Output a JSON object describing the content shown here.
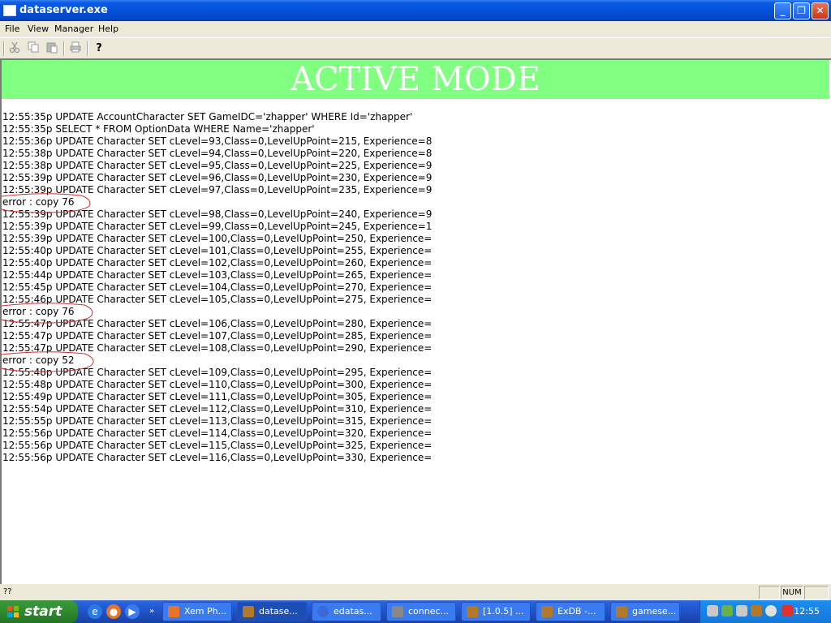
{
  "window": {
    "title": "dataserver.exe",
    "buttons": {
      "minimize": "_",
      "restore": "❐",
      "close": "✕"
    }
  },
  "menu": [
    "File",
    "View",
    "Manager",
    "Help"
  ],
  "toolbar": {
    "icons": [
      "scissors-icon",
      "copy-icon",
      "paste-icon",
      "print-icon",
      "help-icon"
    ],
    "help_glyph": "?"
  },
  "banner": {
    "text": "ACTIVE MODE",
    "color": "#80ff80"
  },
  "log": [
    "12:55:35p UPDATE AccountCharacter SET GameIDC='zhapper' WHERE Id='zhapper'",
    "12:55:35p SELECT * FROM OptionData WHERE Name='zhapper'",
    "12:55:36p UPDATE Character SET cLevel=93,Class=0,LevelUpPoint=215, Experience=8",
    "12:55:38p UPDATE Character SET cLevel=94,Class=0,LevelUpPoint=220, Experience=8",
    "12:55:38p UPDATE Character SET cLevel=95,Class=0,LevelUpPoint=225, Experience=9",
    "12:55:39p UPDATE Character SET cLevel=96,Class=0,LevelUpPoint=230, Experience=9",
    "12:55:39p UPDATE Character SET cLevel=97,Class=0,LevelUpPoint=235, Experience=9",
    "error : copy 76",
    "12:55:39p UPDATE Character SET cLevel=98,Class=0,LevelUpPoint=240, Experience=9",
    "12:55:39p UPDATE Character SET cLevel=99,Class=0,LevelUpPoint=245, Experience=1",
    "12:55:39p UPDATE Character SET cLevel=100,Class=0,LevelUpPoint=250, Experience=",
    "12:55:40p UPDATE Character SET cLevel=101,Class=0,LevelUpPoint=255, Experience=",
    "12:55:40p UPDATE Character SET cLevel=102,Class=0,LevelUpPoint=260, Experience=",
    "12:55:44p UPDATE Character SET cLevel=103,Class=0,LevelUpPoint=265, Experience=",
    "12:55:45p UPDATE Character SET cLevel=104,Class=0,LevelUpPoint=270, Experience=",
    "12:55:46p UPDATE Character SET cLevel=105,Class=0,LevelUpPoint=275, Experience=",
    "error : copy 76",
    "12:55:47p UPDATE Character SET cLevel=106,Class=0,LevelUpPoint=280, Experience=",
    "12:55:47p UPDATE Character SET cLevel=107,Class=0,LevelUpPoint=285, Experience=",
    "12:55:47p UPDATE Character SET cLevel=108,Class=0,LevelUpPoint=290, Experience=",
    "error : copy 52",
    "12:55:48p UPDATE Character SET cLevel=109,Class=0,LevelUpPoint=295, Experience=",
    "12:55:48p UPDATE Character SET cLevel=110,Class=0,LevelUpPoint=300, Experience=",
    "12:55:49p UPDATE Character SET cLevel=111,Class=0,LevelUpPoint=305, Experience=",
    "12:55:54p UPDATE Character SET cLevel=112,Class=0,LevelUpPoint=310, Experience=",
    "12:55:55p UPDATE Character SET cLevel=113,Class=0,LevelUpPoint=315, Experience=",
    "12:55:56p UPDATE Character SET cLevel=114,Class=0,LevelUpPoint=320, Experience=",
    "12:55:56p UPDATE Character SET cLevel=115,Class=0,LevelUpPoint=325, Experience=",
    "12:55:56p UPDATE Character SET cLevel=116,Class=0,LevelUpPoint=330, Experience="
  ],
  "statusbar": {
    "text": "??",
    "panes": [
      "",
      "NUM",
      ""
    ]
  },
  "taskbar": {
    "start_label": "start",
    "overflow_glyph": "»",
    "tasks": [
      {
        "label": "Xem Ph...",
        "active": false,
        "icon_color": "#e8742a"
      },
      {
        "label": "datase...",
        "active": true,
        "icon_color": "#b07a2a"
      },
      {
        "label": "edatas...",
        "active": false,
        "icon_color": "#3a6ad8"
      },
      {
        "label": "connec...",
        "active": false,
        "icon_color": "#888888"
      },
      {
        "label": "[1.0.5] ...",
        "active": false,
        "icon_color": "#b07a2a"
      },
      {
        "label": "ExDB -...",
        "active": false,
        "icon_color": "#b07a2a"
      },
      {
        "label": "gamese...",
        "active": false,
        "icon_color": "#b07a2a"
      }
    ],
    "clock": "12:55"
  }
}
